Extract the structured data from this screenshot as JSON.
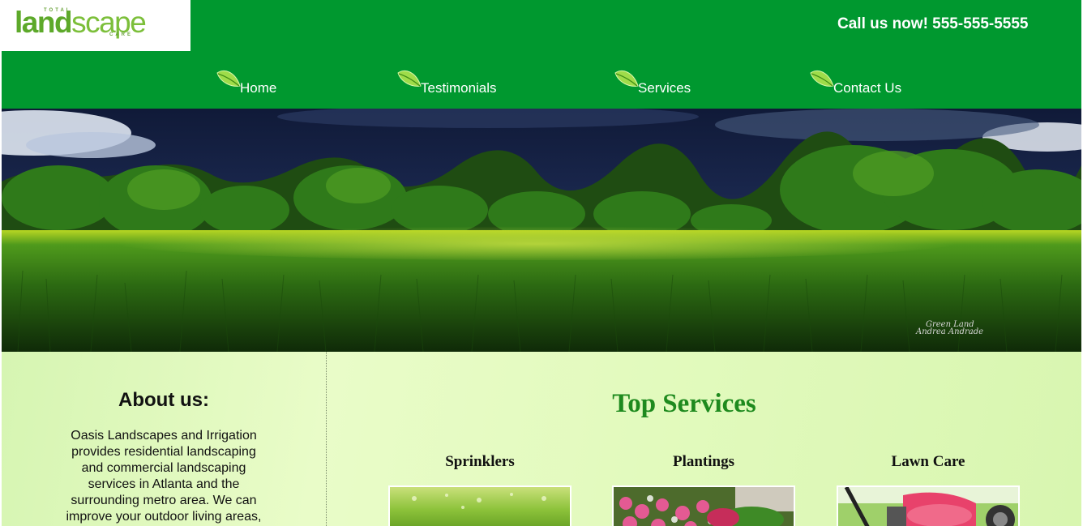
{
  "logo": {
    "word_top": "TOTAL",
    "word_land": "land",
    "word_scape": "scape",
    "word_bottom": "CARE"
  },
  "header": {
    "call_text": "Call us now! 555-555-5555"
  },
  "nav": {
    "items": [
      {
        "label": "Home"
      },
      {
        "label": "Testimonials"
      },
      {
        "label": "Services"
      },
      {
        "label": "Contact Us"
      }
    ]
  },
  "hero": {
    "credit_line1": "Green Land",
    "credit_line2": "Andrea Andrade"
  },
  "about": {
    "title": "About us:",
    "text": "Oasis Landscapes and Irrigation provides residential landscaping and commercial landscaping services in Atlanta and the surrounding metro area. We can improve your outdoor living areas,"
  },
  "services": {
    "title": "Top Services",
    "items": [
      {
        "name": "Sprinklers"
      },
      {
        "name": "Plantings"
      },
      {
        "name": "Lawn Care"
      }
    ]
  },
  "colors": {
    "header_green": "#00982f",
    "services_title_green": "#1e8a1e",
    "content_bg": "#e2fabd"
  },
  "icons": {
    "nav_bullet": "leaf-icon"
  }
}
